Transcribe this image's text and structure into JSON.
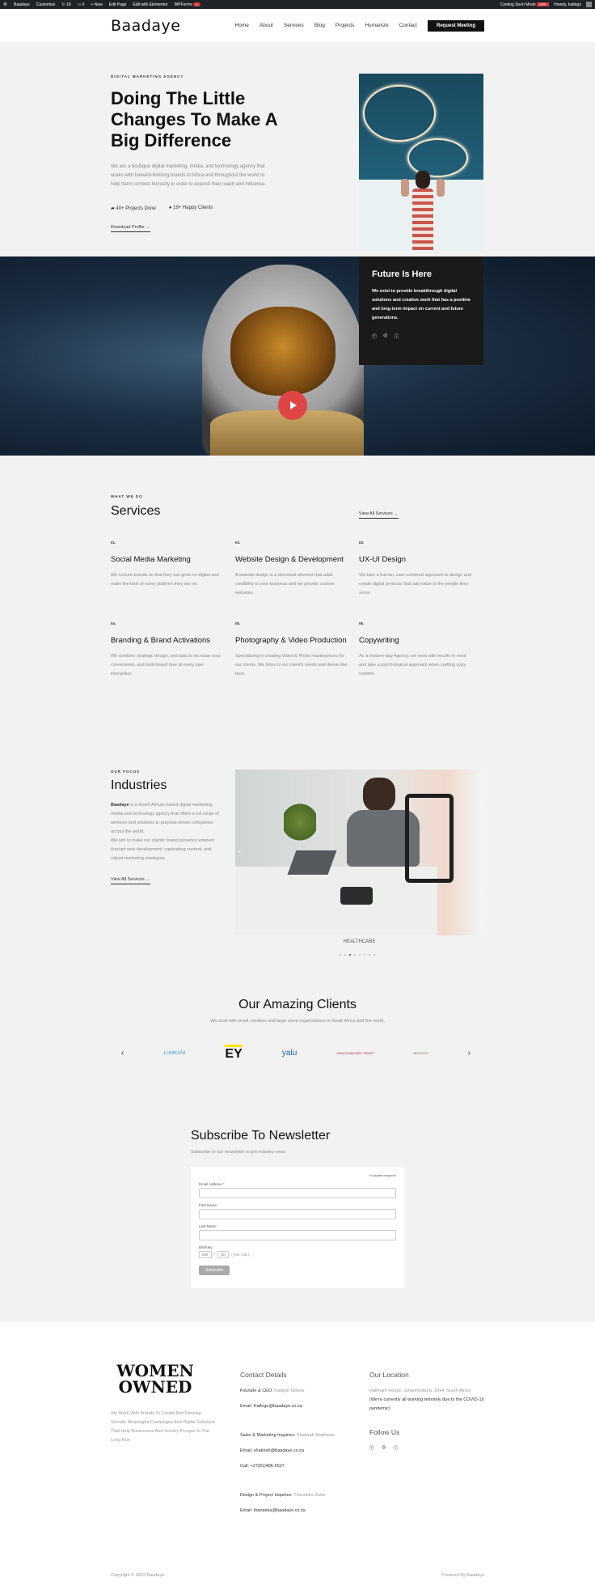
{
  "admin_bar": {
    "site": "Baadaye",
    "customize": "Customize",
    "updates": "19",
    "comments": "0",
    "new": "+ New",
    "edit_page": "Edit Page",
    "elementor": "Edit with Elementor",
    "wpforms": "WPForms",
    "wpforms_count": "1",
    "coming_soon": "Coming Soon Mode",
    "coming_soon_state": "OFF",
    "howdy": "Howdy, katlego"
  },
  "header": {
    "logo": "Baadaye",
    "nav": [
      "Home",
      "About",
      "Services",
      "Blog",
      "Projects",
      "Humanize",
      "Contact"
    ],
    "cta": "Request Meeting"
  },
  "hero": {
    "eyebrow": "DIGITAL MARKETING AGENCY",
    "title": "Doing The Little Changes To Make A Big Difference",
    "text": "We are a boutique digital marketing, media, and technology agency that works with forward-thinking brands in Africa and throughout the world to help them connect honestly in order to expend their reach and influence.",
    "stat1": "40+ Projects Done",
    "stat2": "19+ Happy Clients",
    "download": "Download Profile →"
  },
  "banner": {
    "title": "Future Is Here",
    "text": "We exist to provide breakthrough digital solutions and creative work that has a positive and long-term impact on current and future generations."
  },
  "services": {
    "eyebrow": "WHAT WE DO",
    "title": "Services",
    "view_all": "View All Services →",
    "items": [
      {
        "num": "01.",
        "title": "Social Media Marketing",
        "text": "We nurture brands so that they can grow on digital and make the best of every platform they are on."
      },
      {
        "num": "02.",
        "title": "Website Design & Development",
        "text": "A website design is a dominant element that adds credibility to your business and we provide custom websites."
      },
      {
        "num": "03.",
        "title": "UX-UI Design",
        "text": "We take a human, user-centered approach to design and create digital products that add value to the people they serve."
      },
      {
        "num": "04.",
        "title": "Branding & Brand Activations",
        "text": "We combine strategic design, and data to increase your conversions, and build brand love at every user interaction."
      },
      {
        "num": "05.",
        "title": "Photography & Video Production",
        "text": "Specializing in creating Video & Photo masterpieces for our clients. We listen to our client's needs and deliver the best."
      },
      {
        "num": "06.",
        "title": "Copywriting",
        "text": "As a modern-day Agency, we work with results in mind and take a psychological approach when crafting copy content."
      }
    ]
  },
  "industries": {
    "eyebrow": "OUR FOCUS",
    "title": "Industries",
    "brand": "Baadaye",
    "text1": " is a South African based digital marketing, media and technology agency that offers a full range of services and solutions to purpose-driven companies across the world.",
    "text2": "We aim to make our clients' brand presence eminent through web development, captivating content, and robust marketing strategies.",
    "view_all": "View All Services →",
    "caption": "HEALTHCARE"
  },
  "clients": {
    "title": "Our Amazing Clients",
    "subtitle": "We work with small, medium and large sized organisations in South Africa and the world.",
    "logos": [
      "LUMKANI",
      "EY",
      "yalu",
      "GRACA MACHEL TRUST",
      "BIOTECH"
    ]
  },
  "newsletter": {
    "title": "Subscribe To Newsletter",
    "subtitle": "Subscribe to our newsletter to get industry news",
    "required_note": "* indicates required",
    "email_label": "Email Address *",
    "first_label": "First Name",
    "last_label": "Last Name",
    "birthday_label": "Birthday",
    "mm": "MM",
    "dd": "DD",
    "date_hint": "( mm / dd )",
    "button": "Subscribe"
  },
  "footer": {
    "women_owned": "WOMEN OWNED",
    "tagline": "We Work With Brands To Create And Develop Socially Meaningful Campaigns And Digital Solutions That Help Businesses And Society Prosper In The Long Run.",
    "contact_title": "Contact Details",
    "founder_label": "Founder & CEO:",
    "founder_name": " Katlego Sekete",
    "founder_email_label": "Email:",
    "founder_email": " Katlego@baadaye.co.za",
    "sales_label": "Sales & Marketing Inquiries:",
    "sales_name": " Shakirah Matthews",
    "sales_email_label": "Email:",
    "sales_email": " shakirah@baadaye.co.za",
    "call_label": "Call:",
    "call": " +27(81)486-6527",
    "design_label": "Design & Project Inquiries:",
    "design_name": " Thandeka Dube",
    "design_email_label": "Email:",
    "design_email": " thandeka@baadaye.co.za",
    "location_title": "Our Location",
    "address": "Hallmark House, Johannesburg, 2094, South Africa",
    "covid": " (We're currently all working remotely due to the COVID-19 pandemic)",
    "follow_title": "Follow Us",
    "copyright": "Copyright © 2022 Baadaye",
    "powered": "Powered By Baadaye"
  }
}
